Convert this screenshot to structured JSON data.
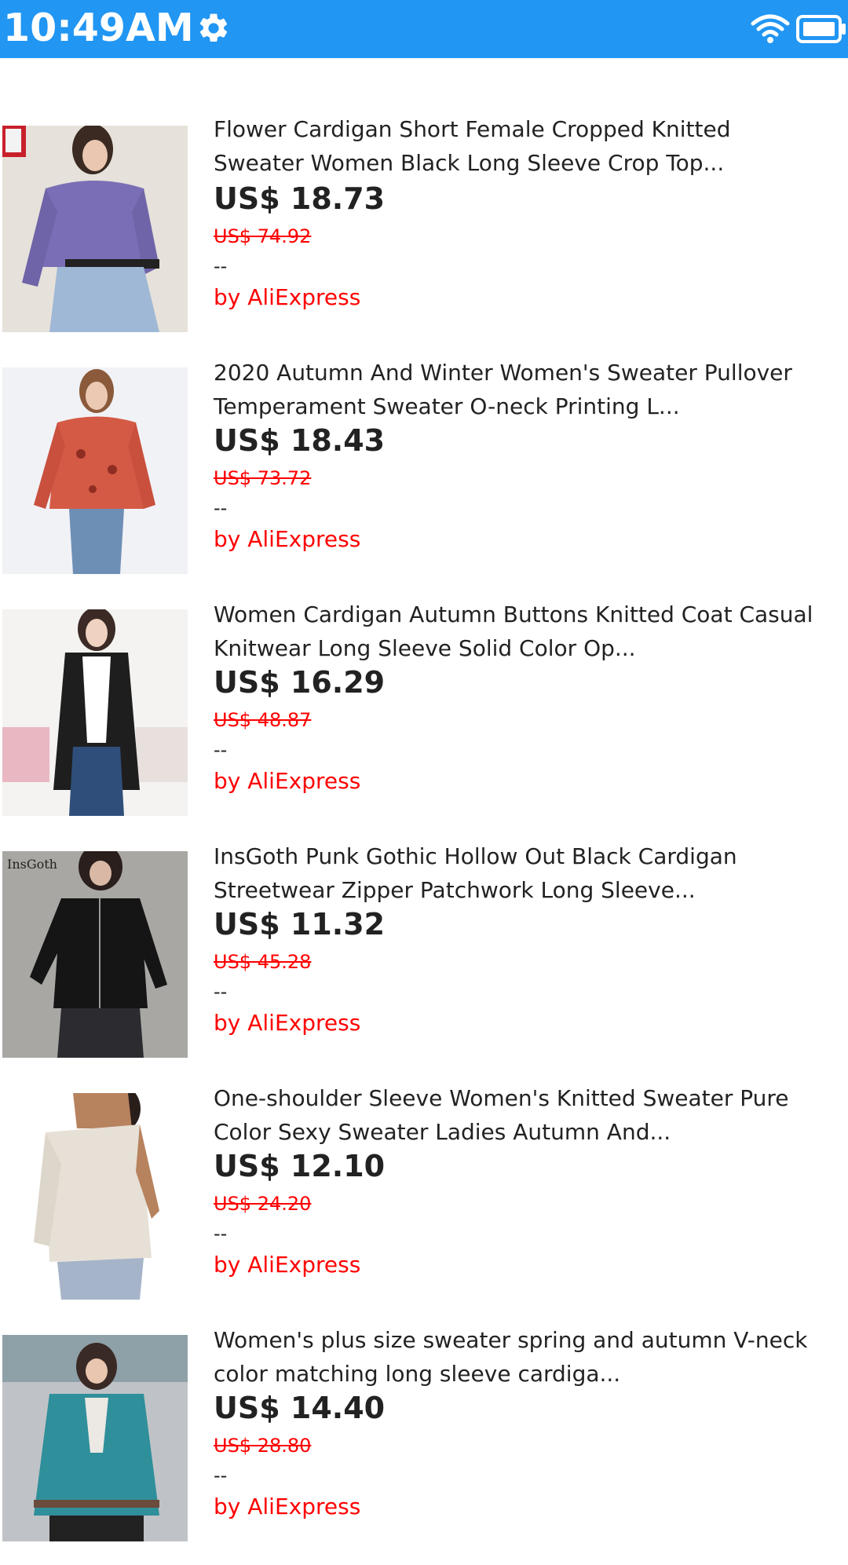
{
  "status_bar": {
    "time": "10:49AM",
    "settings_icon": "gear-icon",
    "wifi_icon": "wifi-icon",
    "battery_icon": "battery-icon",
    "color": "#2196f3"
  },
  "products": [
    {
      "title": "Flower Cardigan Short Female Cropped Knitted\nSweater Women Black Long Sleeve Crop Top...",
      "price": "US$ 18.73",
      "original_price": "US$ 74.92",
      "rating": "--",
      "seller": "by AliExpress"
    },
    {
      "title": "2020 Autumn And Winter Women's Sweater Pullover\nTemperament Sweater O-neck Printing L...",
      "price": "US$ 18.43",
      "original_price": "US$ 73.72",
      "rating": "--",
      "seller": "by AliExpress"
    },
    {
      "title": "Women Cardigan Autumn Buttons Knitted Coat Casual\nKnitwear Long Sleeve Solid Color Op...",
      "price": "US$ 16.29",
      "original_price": "US$ 48.87",
      "rating": "--",
      "seller": "by AliExpress"
    },
    {
      "title": "InsGoth Punk Gothic Hollow Out Black Cardigan\nStreetwear Zipper Patchwork Long Sleeve...",
      "price": "US$ 11.32",
      "original_price": "US$ 45.28",
      "rating": "--",
      "seller": "by AliExpress"
    },
    {
      "title": "One-shoulder Sleeve Women's Knitted Sweater Pure\nColor Sexy Sweater Ladies Autumn And...",
      "price": "US$ 12.10",
      "original_price": "US$ 24.20",
      "rating": "--",
      "seller": "by AliExpress"
    },
    {
      "title": "Women's plus size sweater spring and autumn V-neck\ncolor matching long sleeve cardiga...",
      "price": "US$ 14.40",
      "original_price": "US$ 28.80",
      "rating": "--",
      "seller": "by AliExpress"
    }
  ],
  "colors": {
    "accent": "#2196f3",
    "sale": "#ff0000",
    "text": "#222222"
  }
}
